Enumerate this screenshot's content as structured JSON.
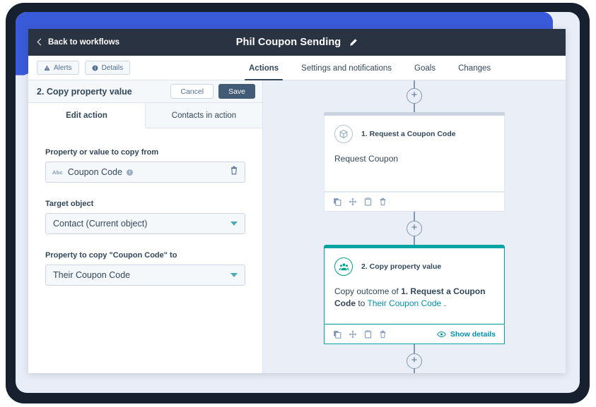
{
  "topbar": {
    "back_label": "Back to workflows",
    "workflow_title": "Phil Coupon Sending",
    "edit_icon": "pencil-icon",
    "back_icon": "chevron-left-icon"
  },
  "navbar": {
    "alerts_label": "Alerts",
    "alerts_icon": "warning-triangle-icon",
    "details_label": "Details",
    "details_icon": "info-circle-icon",
    "tabs": [
      {
        "label": "Actions",
        "active": true
      },
      {
        "label": "Settings and notifications",
        "active": false
      },
      {
        "label": "Goals",
        "active": false
      },
      {
        "label": "Changes",
        "active": false
      }
    ]
  },
  "panel": {
    "header_title": "2. Copy property value",
    "cancel_label": "Cancel",
    "save_label": "Save",
    "tabs": [
      {
        "label": "Edit action",
        "active": true
      },
      {
        "label": "Contacts in action",
        "active": false
      }
    ],
    "fields": {
      "copy_from_label": "Property or value to copy from",
      "copy_from_type": "Abc",
      "copy_from_value": "Coupon Code",
      "copy_from_info": "i",
      "target_object_label": "Target object",
      "target_object_value": "Contact (Current object)",
      "copy_to_label": "Property to copy \"Coupon Code\" to",
      "copy_to_value": "Their Coupon Code"
    }
  },
  "canvas": {
    "add_step_glyph": "+",
    "cards": [
      {
        "title": "1. Request a Coupon Code",
        "icon": "cube-icon",
        "body_prefix": "Request Coupon",
        "body_bold": "",
        "body_mid": "",
        "body_link": "",
        "body_suffix": "",
        "selected": false,
        "show_details_label": "",
        "footer_icons": [
          "duplicate-icon",
          "move-icon",
          "copy-icon",
          "delete-icon"
        ]
      },
      {
        "title": "2. Copy property value",
        "icon": "contacts-icon",
        "body_prefix": "Copy outcome of ",
        "body_bold": "1. Request a Coupon Code",
        "body_mid": " to ",
        "body_link": "Their Coupon Code",
        "body_suffix": " .",
        "selected": true,
        "show_details_label": "Show details",
        "footer_icons": [
          "duplicate-icon",
          "move-icon",
          "copy-icon",
          "delete-icon"
        ]
      }
    ]
  },
  "colors": {
    "bezel": "#16202f",
    "accent_blue": "#3a5bd9",
    "topbar": "#293342",
    "canvas_bg": "#eaeff7",
    "teal": "#00a4a4",
    "link": "#0091ae",
    "save_btn": "#425b76"
  }
}
